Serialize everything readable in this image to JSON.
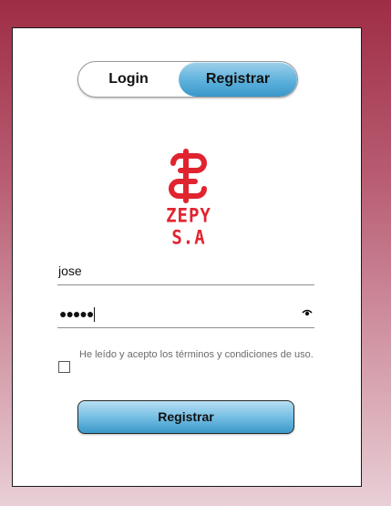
{
  "tabs": {
    "login_label": "Login",
    "register_label": "Registrar",
    "active": "register"
  },
  "brand": {
    "name": "ZEPY S.A",
    "color": "#e0242f"
  },
  "form": {
    "username_value": "jose",
    "password_mask": "●●●●●",
    "password_length": 5,
    "terms_text": "He leído y acepto los términos y condiciones de uso.",
    "terms_checked": false,
    "submit_label": "Registrar"
  },
  "icons": {
    "password_toggle": "eye-icon"
  },
  "colors": {
    "background_top": "#9e2d45",
    "background_bottom": "#e9cfd6",
    "button_blue": "#5cb1dc"
  }
}
